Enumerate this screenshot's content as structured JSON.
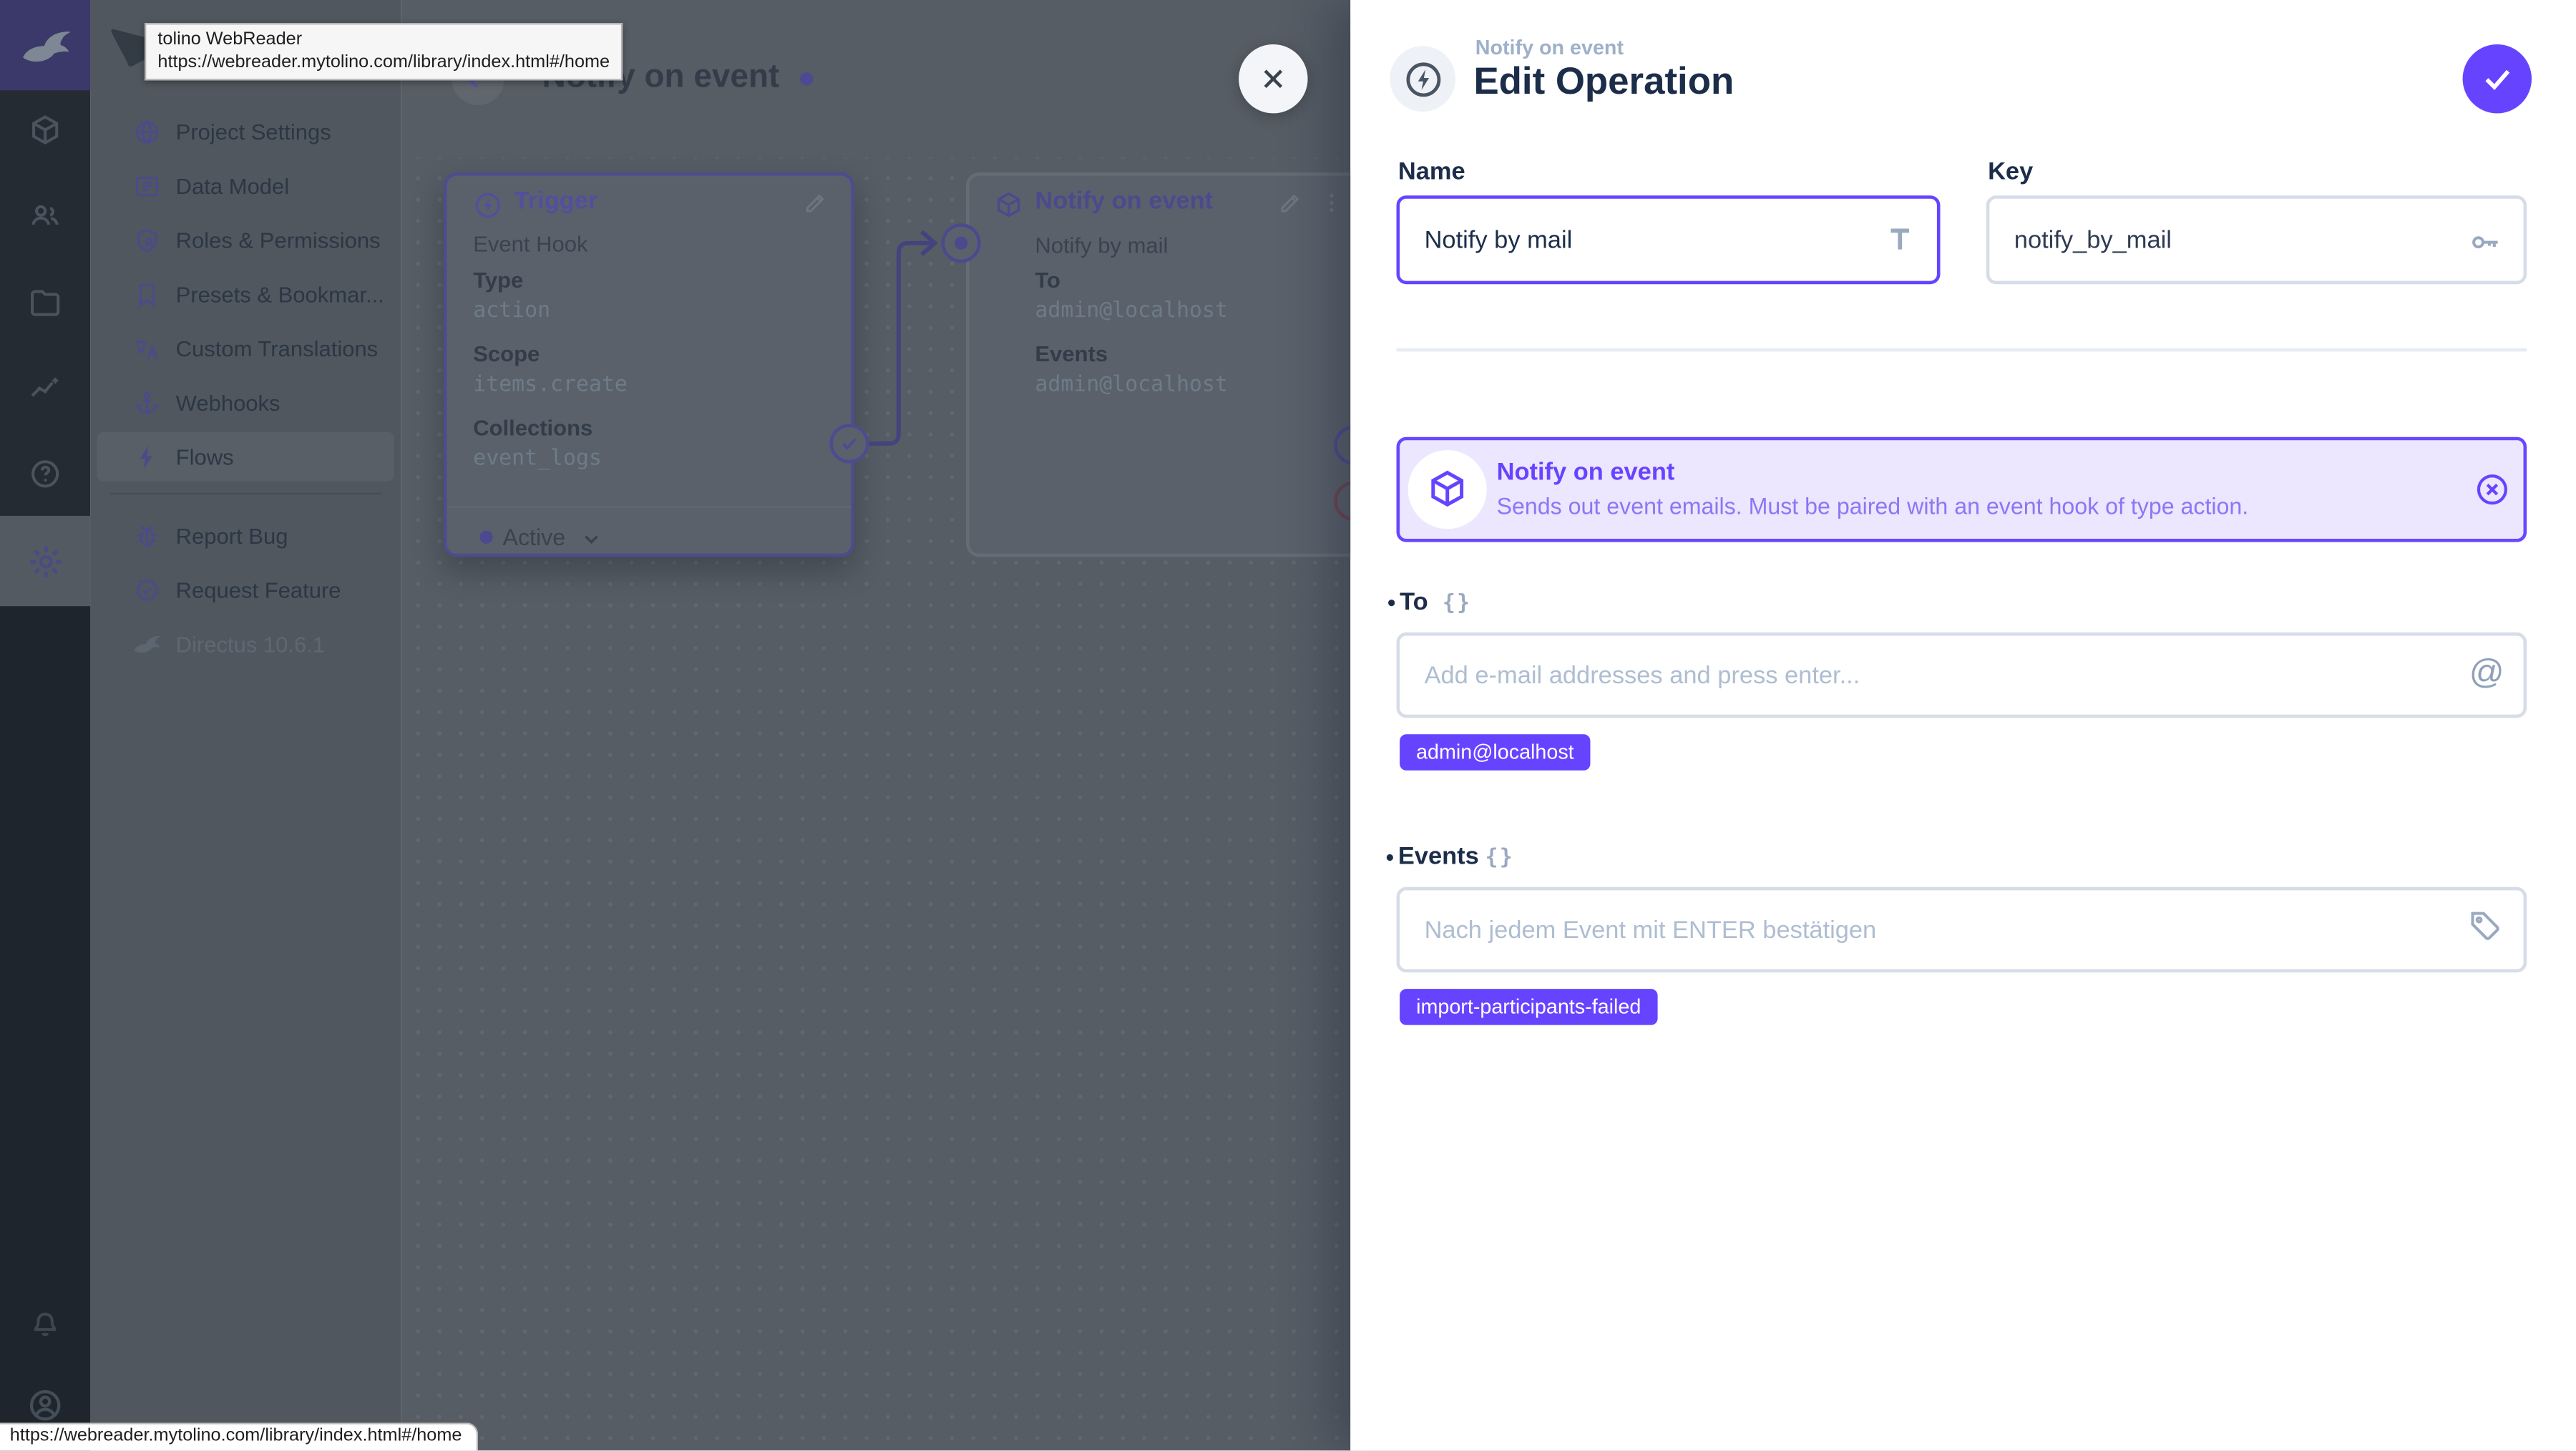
{
  "browser": {
    "tooltip": {
      "title": "tolino WebReader",
      "url": "https://webreader.mytolino.com/library/index.html#/home"
    },
    "status_url": "https://webreader.mytolino.com/library/index.html#/home"
  },
  "module_bar": {
    "logo": "directus-rabbit-logo",
    "modules": [
      "content",
      "users",
      "files",
      "insights",
      "help",
      "settings"
    ],
    "bottom": [
      "notifications",
      "account"
    ]
  },
  "nav": {
    "items": [
      {
        "label": "Project Settings",
        "icon": "globe-icon"
      },
      {
        "label": "Data Model",
        "icon": "list-icon"
      },
      {
        "label": "Roles & Permissions",
        "icon": "shield-person-icon"
      },
      {
        "label": "Presets & Bookmar...",
        "icon": "bookmark-icon"
      },
      {
        "label": "Custom Translations",
        "icon": "translate-icon"
      },
      {
        "label": "Webhooks",
        "icon": "anchor-icon"
      },
      {
        "label": "Flows",
        "icon": "bolt-icon"
      }
    ],
    "footer_items": [
      {
        "label": "Report Bug",
        "icon": "bug-icon"
      },
      {
        "label": "Request Feature",
        "icon": "badge-check-icon"
      }
    ],
    "version": "Directus 10.6.1"
  },
  "flow": {
    "title": "Notify on event",
    "trigger_panel": {
      "title": "Trigger",
      "type_label": "Event Hook",
      "fields": [
        {
          "label": "Type",
          "value": "action"
        },
        {
          "label": "Scope",
          "value": "items.create"
        },
        {
          "label": "Collections",
          "value": "event_logs"
        }
      ],
      "status": "Active"
    },
    "operation_panel": {
      "title": "Notify on event",
      "name": "Notify by mail",
      "fields": [
        {
          "label": "To",
          "value": "admin@localhost"
        },
        {
          "label": "Events",
          "value": "admin@localhost"
        }
      ]
    }
  },
  "drawer": {
    "subtitle": "Notify on event",
    "title": "Edit Operation",
    "name_field": {
      "label": "Name",
      "value": "Notify by mail"
    },
    "key_field": {
      "label": "Key",
      "value": "notify_by_mail"
    },
    "info_box": {
      "title": "Notify on event",
      "description": "Sends out event emails. Must be paired with an event hook of type action."
    },
    "to_field": {
      "label": "To",
      "placeholder": "Add e-mail addresses and press enter...",
      "chips": [
        "admin@localhost"
      ]
    },
    "events_field": {
      "label": "Events",
      "placeholder": "Nach jedem Event mit ENTER bestätigen",
      "chips": [
        "import-participants-failed"
      ]
    },
    "accent_color": "#6644ff",
    "glyphs": {
      "braces": "{}",
      "at": "@"
    }
  }
}
